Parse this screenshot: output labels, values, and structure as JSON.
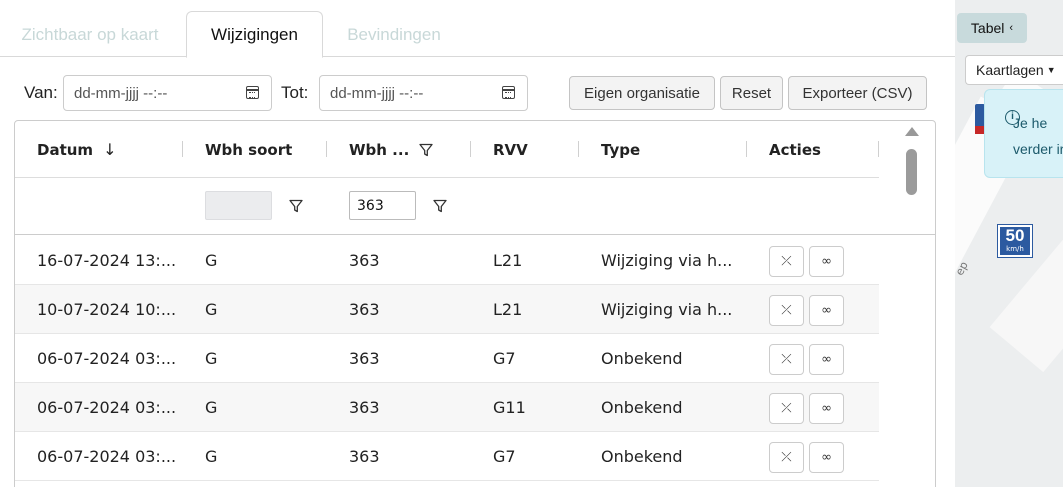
{
  "tabs": [
    {
      "label": "Zichtbaar op kaart",
      "active": false
    },
    {
      "label": "Wijzigingen",
      "active": true
    },
    {
      "label": "Bevindingen",
      "active": false
    }
  ],
  "filters": {
    "van_label": "Van:",
    "van_value": "dd-mm-jjjj --:--",
    "tot_label": "Tot:",
    "tot_value": "dd-mm-jjjj --:--",
    "buttons": [
      "Eigen organisatie",
      "Reset",
      "Exporteer (CSV)"
    ]
  },
  "table": {
    "columns": [
      "Datum",
      "Wbh soort",
      "Wbh ...",
      "RVV",
      "Type",
      "Acties"
    ],
    "filter_values": {
      "wbh_soort": "",
      "wbh_nummer": "363"
    },
    "rows": [
      {
        "datum": "16-07-2024 13:...",
        "wbh_soort": "G",
        "wbh": "363",
        "rvv": "L21",
        "type": "Wijziging via h..."
      },
      {
        "datum": "10-07-2024 10:...",
        "wbh_soort": "G",
        "wbh": "363",
        "rvv": "L21",
        "type": "Wijziging via h..."
      },
      {
        "datum": "06-07-2024 03:...",
        "wbh_soort": "G",
        "wbh": "363",
        "rvv": "G7",
        "type": "Onbekend"
      },
      {
        "datum": "06-07-2024 03:...",
        "wbh_soort": "G",
        "wbh": "363",
        "rvv": "G11",
        "type": "Onbekend"
      },
      {
        "datum": "06-07-2024 03:...",
        "wbh_soort": "G",
        "wbh": "363",
        "rvv": "G7",
        "type": "Onbekend"
      }
    ],
    "action_icons": [
      "collapse-icon",
      "glasses-icon"
    ]
  },
  "map": {
    "tabel_label": "Tabel",
    "kaartlagen_label": "Kaartlagen",
    "info_text_line1": "Je he",
    "info_text_line2": "verder ir",
    "speed_sign_value": "50",
    "speed_sign_unit": "km/h",
    "street_label": "ep"
  }
}
